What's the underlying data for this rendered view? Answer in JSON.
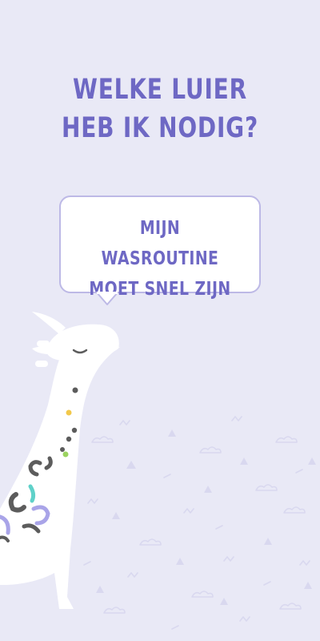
{
  "title": {
    "line1": "WELKE LUIER",
    "line2": "HEB IK NODIG?"
  },
  "speech_bubble": {
    "line1": "MIJN WASROUTINE",
    "line2": "MOET SNEL ZIJN"
  },
  "colors": {
    "background": "#e9e9f6",
    "accent": "#6e68c4",
    "bubble_border": "#bdb9e6",
    "giraffe": "#ffffff",
    "spot_dark": "#6a6a6a",
    "spot_yellow": "#f2c84b",
    "spot_green": "#9bd35f",
    "spot_teal": "#5fd1c9",
    "spot_purple": "#a9a4e8"
  },
  "illustration": {
    "character": "giraffe",
    "pattern": "clouds-triangles-zigzags"
  }
}
